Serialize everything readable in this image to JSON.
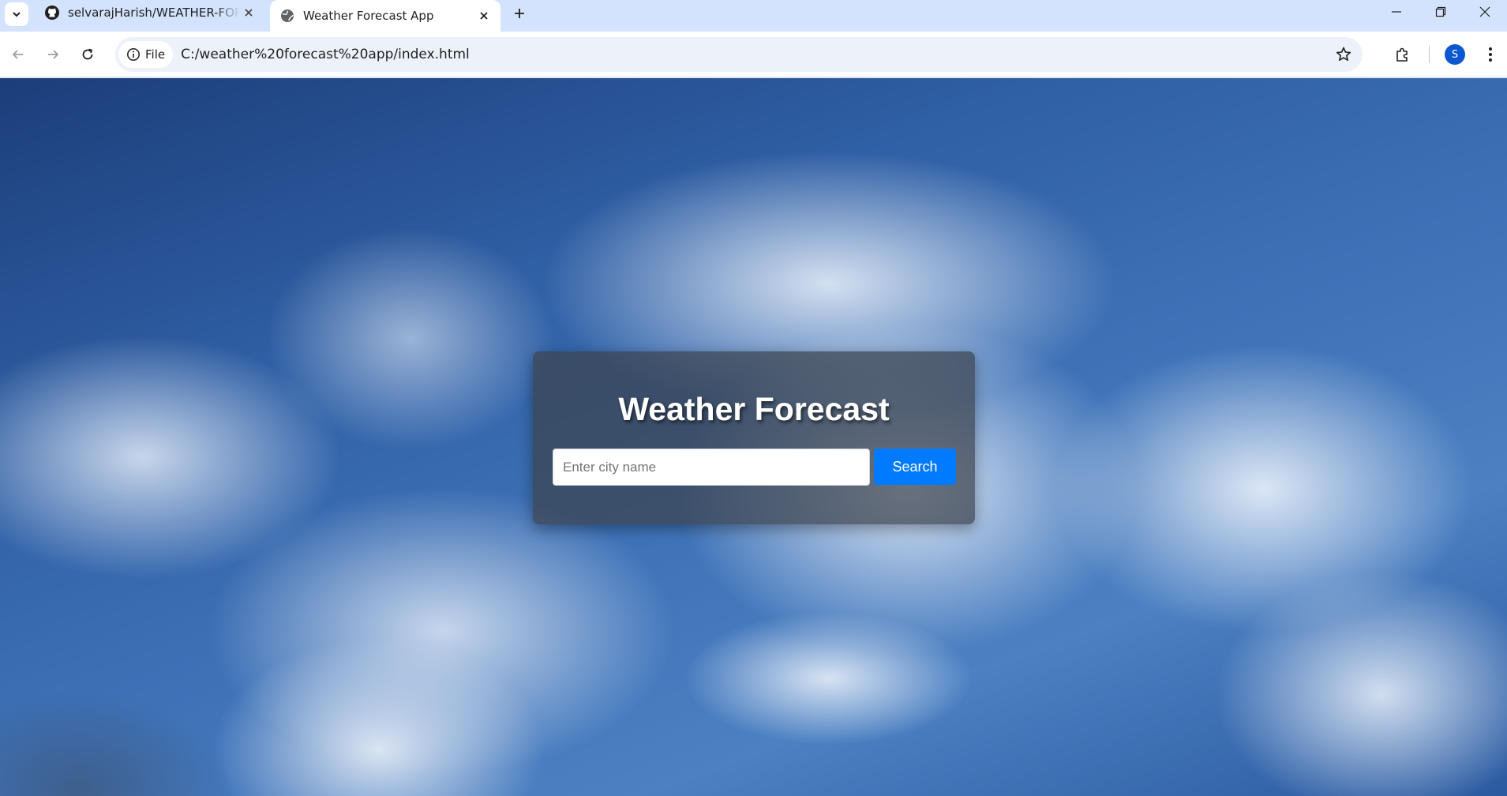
{
  "browser": {
    "tabs": [
      {
        "title": "selvarajHarish/WEATHER-FORECAST",
        "icon": "github-icon",
        "active": false
      },
      {
        "title": "Weather Forecast App",
        "icon": "globe-icon",
        "active": true
      }
    ],
    "site_chip_label": "File",
    "url": "C:/weather%20forecast%20app/index.html",
    "profile_initial": "S"
  },
  "page": {
    "title": "Weather Forecast",
    "search": {
      "placeholder": "Enter city name",
      "value": "",
      "button_label": "Search"
    }
  },
  "colors": {
    "search_button": "#007bff",
    "tab_strip": "#d3e3fd",
    "avatar": "#0b57d0"
  }
}
